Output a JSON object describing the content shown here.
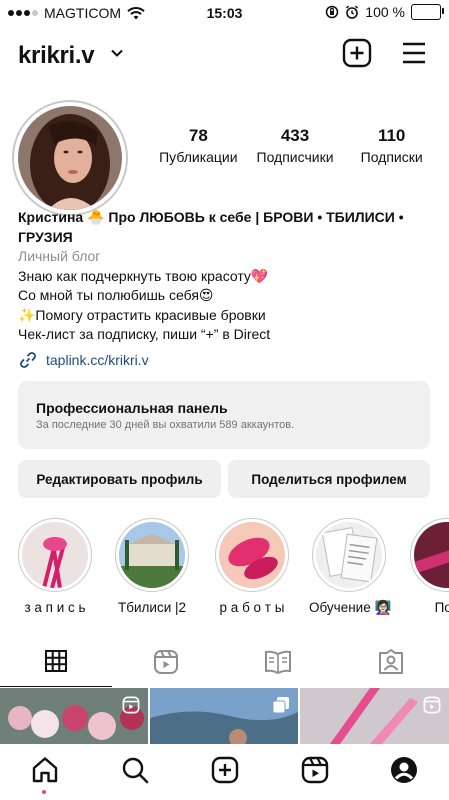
{
  "status_bar": {
    "carrier": "MAGTICOM",
    "time": "15:03",
    "battery": "100 %",
    "battery_level": 1.0
  },
  "header": {
    "username": "krikri.v"
  },
  "stats": [
    {
      "value": "78",
      "label": "Публикации"
    },
    {
      "value": "433",
      "label": "Подписчики"
    },
    {
      "value": "110",
      "label": "Подписки"
    }
  ],
  "bio": {
    "name": "Кристина 🐣 Про ЛЮБОВЬ к себе | БРОВИ • ТБИЛИСИ • ГРУЗИЯ",
    "category": "Личный блог",
    "lines": [
      "Знаю как подчеркнуть твою красоту💖",
      "Со мной ты полюбишь себя😍",
      "✨Помогу отрастить красивые бровки",
      "Чек-лист за подписку, пиши “+” в Direct"
    ],
    "link": "taplink.cc/krikri.v"
  },
  "pro_panel": {
    "title": "Профессиональная панель",
    "subtitle": "За последние 30 дней вы охватили 589 аккаунтов."
  },
  "buttons": {
    "edit": "Редактировать профиль",
    "share": "Поделиться профилем"
  },
  "highlights": [
    {
      "label": "з а п и с ь"
    },
    {
      "label": "Тбилиси |2"
    },
    {
      "label": "р а б о т ы"
    },
    {
      "label": "Обучение 👩🏻‍🏫"
    },
    {
      "label": "Пол"
    }
  ],
  "tabs": [
    "grid-icon",
    "reels-icon",
    "guide-icon",
    "tagged-icon"
  ],
  "colors": {
    "link": "#1b4c80",
    "battery": "#f2c200",
    "notification_dot": "#ed4956"
  }
}
